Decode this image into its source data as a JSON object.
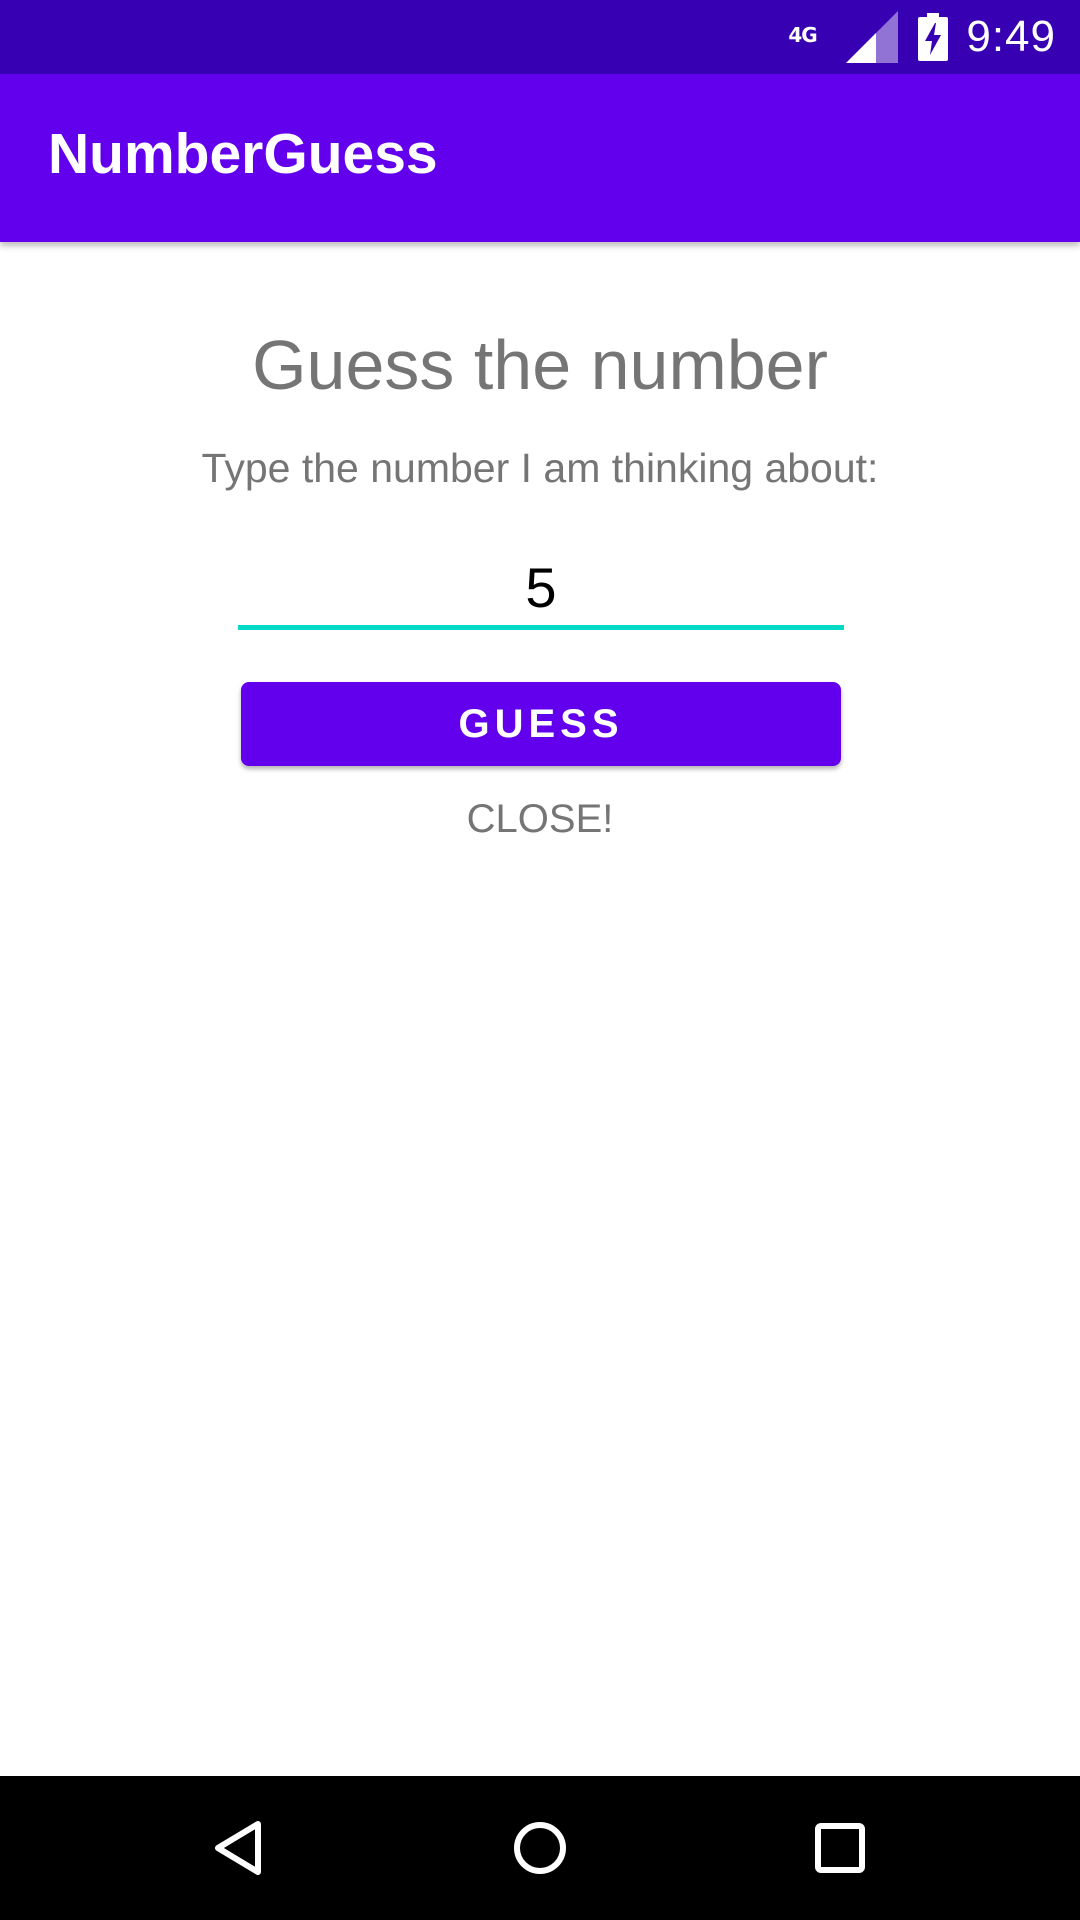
{
  "status_bar": {
    "network": "4G",
    "time": "9:49"
  },
  "app_bar": {
    "title": "NumberGuess"
  },
  "main": {
    "heading": "Guess the number",
    "subtitle": "Type the number I am thinking about:",
    "input_value": "5",
    "guess_button_label": "GUESS",
    "result_text": "CLOSE!"
  },
  "colors": {
    "status_bar": "#3700b3",
    "primary": "#6200ee",
    "accent": "#03dac5",
    "secondary_text": "#757575"
  },
  "nav_bar": {
    "icons": [
      "back-icon",
      "home-icon",
      "recents-icon"
    ]
  }
}
